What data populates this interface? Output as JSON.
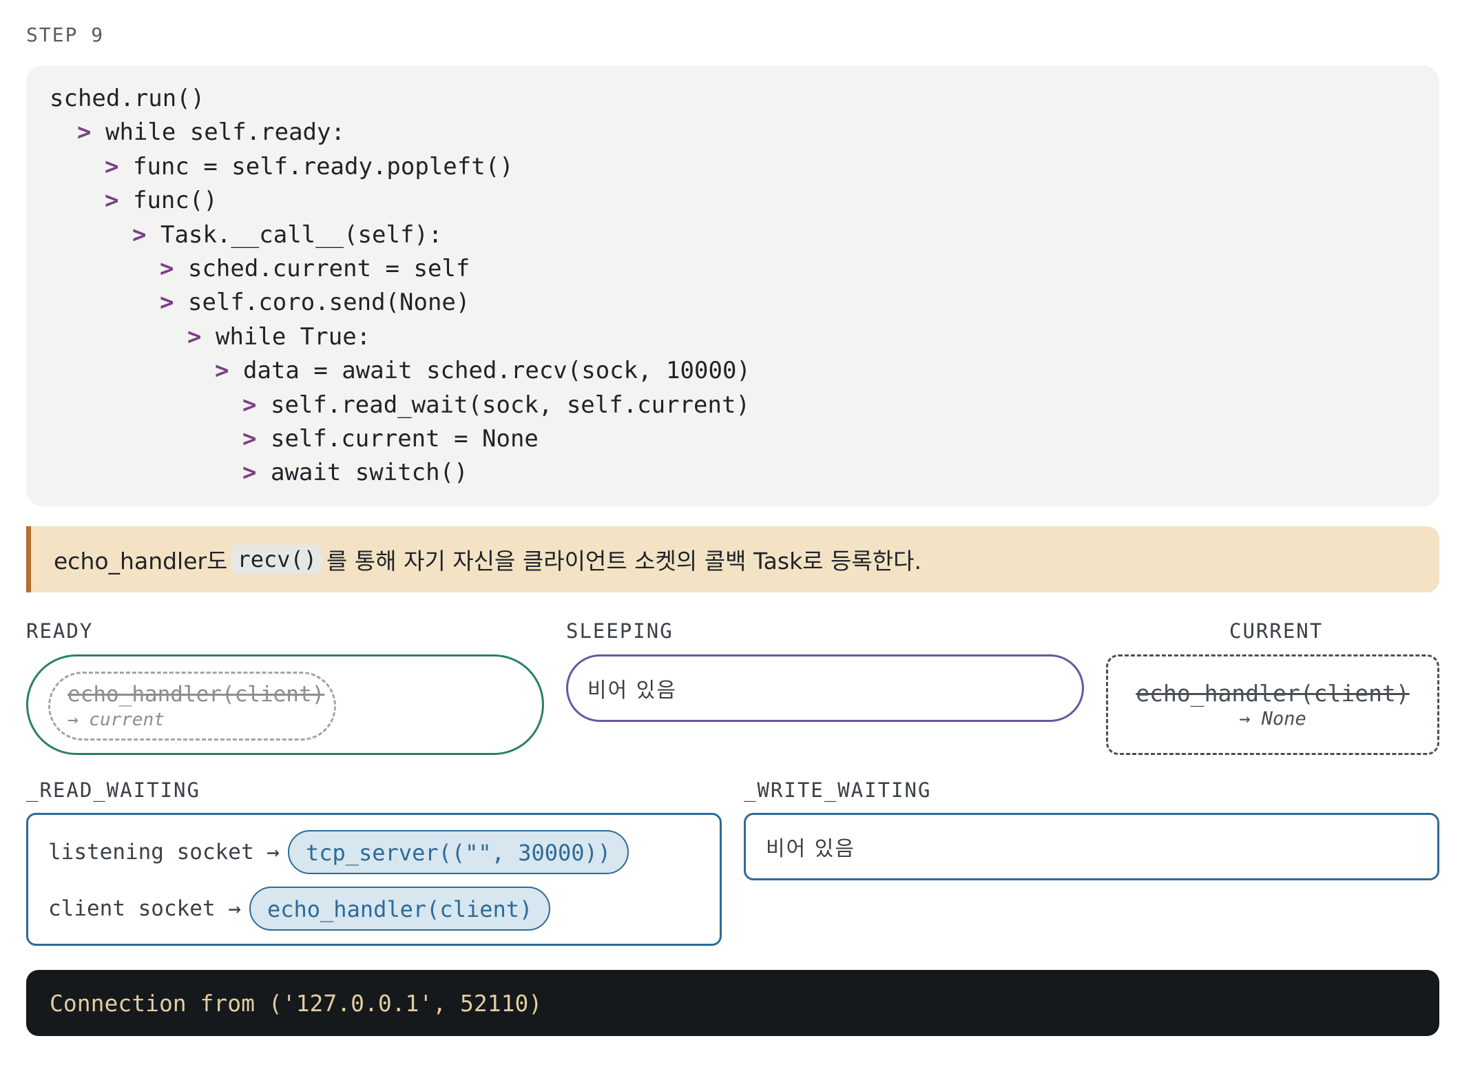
{
  "step_label": "STEP 9",
  "code_lines": [
    {
      "arrow": "",
      "text": "sched.run()"
    },
    {
      "arrow": ">",
      "text": "while self.ready:"
    },
    {
      "arrow": ">",
      "text": "func = self.ready.popleft()"
    },
    {
      "arrow": ">",
      "text": "func()"
    },
    {
      "arrow": ">",
      "text": "Task.__call__(self):"
    },
    {
      "arrow": ">",
      "text": "sched.current = self"
    },
    {
      "arrow": ">",
      "text": "self.coro.send(None)"
    },
    {
      "arrow": ">",
      "text": "while True:"
    },
    {
      "arrow": ">",
      "text": "data = await sched.recv(sock, 10000)"
    },
    {
      "arrow": ">",
      "text": "self.read_wait(sock, self.current)"
    },
    {
      "arrow": ">",
      "text": "self.current = None"
    },
    {
      "arrow": ">",
      "text": "await switch()"
    }
  ],
  "note": {
    "before": "echo_handler도",
    "code": "recv()",
    "after": "를 통해 자기 자신을 클라이언트 소켓의 콜백 Task로 등록한다."
  },
  "ready": {
    "label": "READY",
    "item": "echo_handler(client)",
    "item_note": "→ current"
  },
  "sleeping": {
    "label": "SLEEPING",
    "empty": "비어 있음"
  },
  "current": {
    "label": "CURRENT",
    "item": "echo_handler(client)",
    "item_note": "→ None"
  },
  "read_waiting": {
    "label": "_READ_WAITING",
    "rows": [
      {
        "key": "listening socket →",
        "value": "tcp_server((\"\", 30000))"
      },
      {
        "key": "client socket →",
        "value": "echo_handler(client)"
      }
    ]
  },
  "write_waiting": {
    "label": "_WRITE_WAITING",
    "empty": "비어 있음"
  },
  "terminal": {
    "output": "Connection from ('127.0.0.1', 52110)"
  },
  "colors": {
    "ready_border": "#2a7f6a",
    "sleeping_border": "#6b55a0",
    "waiting_border": "#2d6a98",
    "code_arrow": "#7b3f86",
    "note_background": "#f4e2c4",
    "note_accent": "#b86e2d",
    "terminal_text": "#e3cda0"
  }
}
